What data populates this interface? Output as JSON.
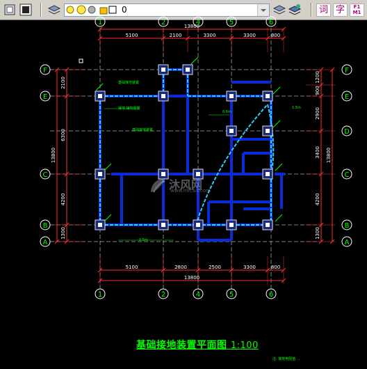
{
  "toolbar": {
    "layer_value": "0",
    "text_buttons": [
      "词",
      "字",
      "F1 M1"
    ]
  },
  "plan": {
    "top_dims": [
      "5100",
      "2100",
      "3300",
      "3300",
      "800"
    ],
    "top_total": "13800",
    "bottom_dims": [
      "5100",
      "2800",
      "2500",
      "3300",
      "800"
    ],
    "bottom_total": "13800",
    "left_dims": [
      "2100",
      "6300",
      "4200",
      "1300"
    ],
    "left_total": "13800",
    "right_dims": [
      "1200",
      "900",
      "2900",
      "3400",
      "4200",
      "1300"
    ],
    "right_total": "13800",
    "col_axes": [
      "1",
      "2",
      "4",
      "5",
      "6"
    ],
    "row_axes_left": [
      "F",
      "E",
      "C",
      "B",
      "A"
    ],
    "row_axes_right": [
      "F",
      "E",
      "D",
      "C",
      "B",
      "A"
    ],
    "annotations": [
      "基础接地装置",
      "接地  接地装置",
      "0.5m",
      "0.6m",
      "1.5m"
    ]
  },
  "title": {
    "main": "基础接地装置平面图",
    "scale": "1:100"
  },
  "watermark": {
    "name": "沐风网",
    "url": "www.mfcad.com"
  },
  "colors": {
    "toolbar_bg": "#d4d0c8",
    "canvas_bg": "#000000",
    "dim": "#ff3030",
    "axis": "#ffffff",
    "earth": "#33ccff",
    "wall": "#0a2bd8",
    "label": "#00ff00"
  }
}
